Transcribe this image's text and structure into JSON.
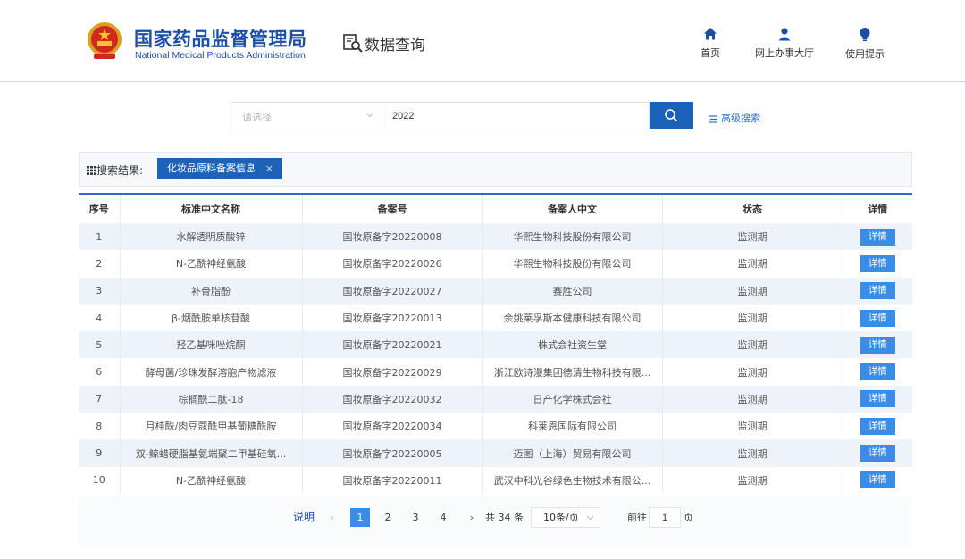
{
  "header": {
    "org_cn": "国家药品监督管理局",
    "org_en": "National Medical Products Administration",
    "section_title": "数据查询",
    "nav": [
      {
        "label": "首页",
        "icon": "home-icon"
      },
      {
        "label": "网上办事大厅",
        "icon": "user-icon"
      },
      {
        "label": "使用提示",
        "icon": "lightbulb-icon"
      }
    ]
  },
  "search": {
    "select_placeholder": "请选择",
    "query": "2022",
    "advanced_label": "高级搜索"
  },
  "results": {
    "label": "搜索结果:",
    "tag": "化妆品原料备案信息",
    "tag_close": "×"
  },
  "table": {
    "headers": [
      "序号",
      "标准中文名称",
      "备案号",
      "备案人中文",
      "状态",
      "详情"
    ],
    "rows": [
      {
        "no": "1",
        "name": "水解透明质酸锌",
        "record": "国妆原备字20220008",
        "applicant": "华熙生物科技股份有限公司",
        "status": "监测期",
        "action": "详情"
      },
      {
        "no": "2",
        "name": "N-乙酰神经氨酸",
        "record": "国妆原备字20220026",
        "applicant": "华熙生物科技股份有限公司",
        "status": "监测期",
        "action": "详情"
      },
      {
        "no": "3",
        "name": "补骨脂酚",
        "record": "国妆原备字20220027",
        "applicant": "赛胜公司",
        "status": "监测期",
        "action": "详情"
      },
      {
        "no": "4",
        "name": "β-烟酰胺单核苷酸",
        "record": "国妆原备字20220013",
        "applicant": "余姚莱孚斯本健康科技有限公司",
        "status": "监测期",
        "action": "详情"
      },
      {
        "no": "5",
        "name": "羟乙基咪唑烷酮",
        "record": "国妆原备字20220021",
        "applicant": "株式会社资生堂",
        "status": "监测期",
        "action": "详情"
      },
      {
        "no": "6",
        "name": "酵母菌/珍珠发酵溶胞产物滤液",
        "record": "国妆原备字20220029",
        "applicant": "浙江欧诗漫集团德清生物科技有限...",
        "status": "监测期",
        "action": "详情"
      },
      {
        "no": "7",
        "name": "棕榈酰二肽-18",
        "record": "国妆原备字20220032",
        "applicant": "日产化学株式会社",
        "status": "监测期",
        "action": "详情"
      },
      {
        "no": "8",
        "name": "月桂酰/肉豆蔻酰甲基葡糖酰胺",
        "record": "国妆原备字20220034",
        "applicant": "科莱恩国际有限公司",
        "status": "监测期",
        "action": "详情"
      },
      {
        "no": "9",
        "name": "双-鲸蜡硬脂基氨端聚二甲基硅氧...",
        "record": "国妆原备字20220005",
        "applicant": "迈图（上海）贸易有限公司",
        "status": "监测期",
        "action": "详情"
      },
      {
        "no": "10",
        "name": "N-乙酰神经氨酸",
        "record": "国妆原备字20220011",
        "applicant": "武汉中科光谷绿色生物技术有限公...",
        "status": "监测期",
        "action": "详情"
      }
    ]
  },
  "pagination": {
    "note": "说明",
    "prev": "‹",
    "next": "›",
    "pages": [
      "1",
      "2",
      "3",
      "4"
    ],
    "active_page": "1",
    "total": "共 34 条",
    "page_size": "10条/页",
    "goto_label": "前往",
    "goto_value": "1",
    "page_unit": "页"
  },
  "colors": {
    "brand_blue": "#1d4ea6",
    "button_blue": "#1b62b8",
    "detail_blue": "#3a8de6"
  }
}
